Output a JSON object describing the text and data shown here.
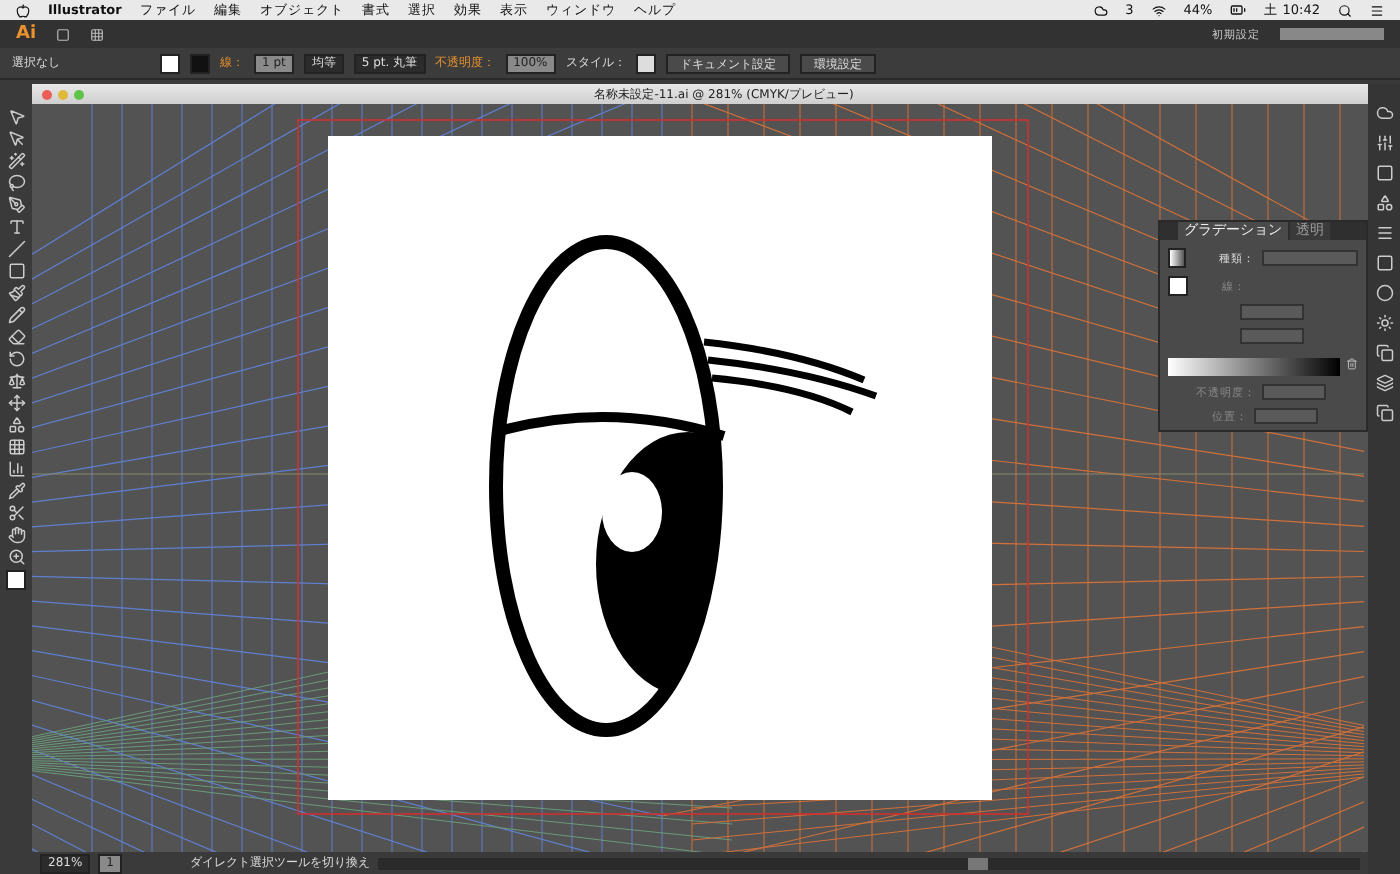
{
  "menu_bar": {
    "app": "Illustrator",
    "items": [
      "ファイル",
      "編集",
      "オブジェクト",
      "書式",
      "選択",
      "効果",
      "表示",
      "ウィンドウ",
      "ヘルプ"
    ],
    "status": {
      "badge": "3",
      "battery": "44%",
      "clock": "土 10:42"
    }
  },
  "app_bar": {
    "logo": "Ai",
    "workspace": "初期設定"
  },
  "control_bar": {
    "selection": "選択なし",
    "stroke_label": "線：",
    "stroke_weight": "1 pt",
    "profile": "均等",
    "brush": "5 pt. 丸筆",
    "opacity_label": "不透明度：",
    "opacity": "100%",
    "style_label": "スタイル：",
    "buttons": [
      "ドキュメント設定",
      "環境設定"
    ]
  },
  "document": {
    "title": "名称未設定-11.ai @ 281% (CMYK/プレビュー)"
  },
  "gradient_panel": {
    "tabs": [
      {
        "label": "グラデーション",
        "selected": true
      },
      {
        "label": "透明",
        "selected": false
      }
    ],
    "type_label": "種類：",
    "stroke_label": "線：",
    "opacity_label": "不透明度：",
    "location_label": "位置："
  },
  "status_bar": {
    "zoom": "281%",
    "page": "1",
    "message": "ダイレクト選択ツールを切り換え"
  }
}
